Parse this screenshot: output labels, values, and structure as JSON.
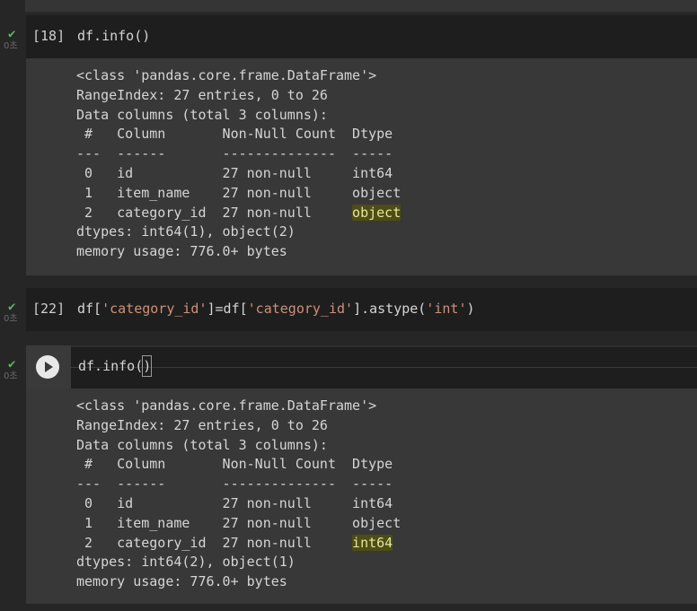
{
  "cells": [
    {
      "exec_count": "[18]",
      "code": "df.info()",
      "status_time": "0초",
      "output_lines": [
        "<class 'pandas.core.frame.DataFrame'>",
        "RangeIndex: 27 entries, 0 to 26",
        "Data columns (total 3 columns):",
        " #   Column       Non-Null Count  Dtype ",
        "---  ------       --------------  ----- ",
        " 0   id           27 non-null     int64 ",
        " 1   item_name    27 non-null     object",
        " 2   category_id  27 non-null     ",
        "dtypes: int64(1), object(2)",
        "memory usage: 776.0+ bytes"
      ],
      "highlighted_dtype": "object"
    },
    {
      "exec_count": "[22]",
      "code_prefix": "df[",
      "code_str1": "'category_id'",
      "code_mid": "]=df[",
      "code_str2": "'category_id'",
      "code_mid2": "].astype(",
      "code_str3": "'int'",
      "code_suffix": ")",
      "status_time": "0초"
    },
    {
      "code_before_cursor": "df.info(",
      "code_cursor": "()",
      "status_time": "0초",
      "output_lines": [
        "<class 'pandas.core.frame.DataFrame'>",
        "RangeIndex: 27 entries, 0 to 26",
        "Data columns (total 3 columns):",
        " #   Column       Non-Null Count  Dtype ",
        "---  ------       --------------  ----- ",
        " 0   id           27 non-null     int64 ",
        " 1   item_name    27 non-null     object",
        " 2   category_id  27 non-null     ",
        "dtypes: int64(2), object(1)",
        "memory usage: 776.0+ bytes"
      ],
      "highlighted_dtype": "int64"
    }
  ],
  "icons": {
    "success": "check-icon",
    "run": "play-icon"
  },
  "colors": {
    "success": "#5bb55b",
    "string_literal": "#ce9178",
    "highlight_bg": "#4d4d14"
  }
}
